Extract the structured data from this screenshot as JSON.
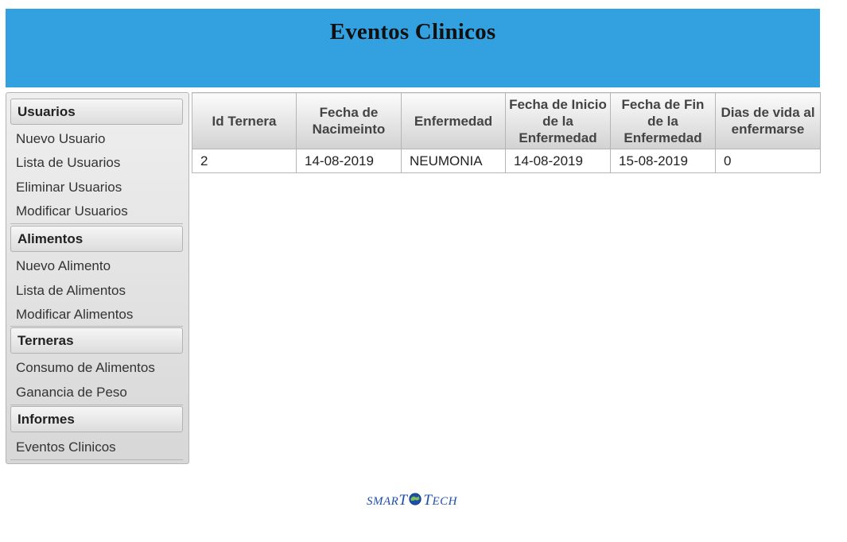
{
  "header": {
    "title": "Eventos Clinicos"
  },
  "sidebar": {
    "sections": [
      {
        "title": "Usuarios",
        "items": [
          "Nuevo Usuario",
          "Lista de Usuarios",
          "Eliminar Usuarios",
          "Modificar Usuarios"
        ]
      },
      {
        "title": "Alimentos",
        "items": [
          "Nuevo Alimento",
          "Lista de Alimentos",
          "Modificar Alimentos"
        ]
      },
      {
        "title": "Terneras",
        "items": [
          "Consumo de Alimentos",
          "Ganancia de Peso"
        ]
      },
      {
        "title": "Informes",
        "items": [
          "Eventos Clinicos"
        ]
      }
    ]
  },
  "table": {
    "headers": [
      "Id Ternera",
      "Fecha de Nacimeinto",
      "Enfermedad",
      "Fecha de Inicio de la Enfermedad",
      "Fecha de Fin de la Enfermedad",
      "Dias de vida al enfermarse"
    ],
    "rows": [
      [
        "2",
        "14-08-2019",
        "NEUMONIA",
        "14-08-2019",
        "15-08-2019",
        "0"
      ]
    ]
  },
  "footer": {
    "logo": {
      "part1": "SMAR",
      "part1_cap": "S",
      "t1": "T",
      "t2": "T",
      "part2": "ECH",
      "icon": "globe-icon"
    }
  },
  "colors": {
    "header_bg": "#33a0e0",
    "logo": "#1d4fa8"
  }
}
